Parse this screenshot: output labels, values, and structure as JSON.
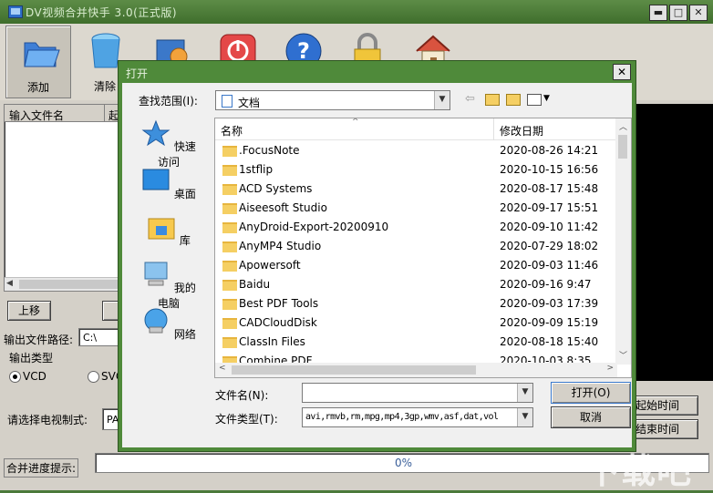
{
  "app": {
    "title": "DV视频合并快手 3.0(正式版)",
    "window_buttons": [
      "▬",
      "□",
      "✕"
    ],
    "toolbar": [
      {
        "label": "添加",
        "icon": "folder-icon"
      },
      {
        "label": "清除",
        "icon": "trash-bin-icon"
      },
      {
        "label": "",
        "icon": "merge-icon"
      },
      {
        "label": "",
        "icon": "stop-icon"
      },
      {
        "label": "",
        "icon": "help-icon"
      },
      {
        "label": "",
        "icon": "lock-icon"
      },
      {
        "label": "",
        "icon": "home-icon"
      }
    ],
    "list_headers": {
      "input_file": "输入文件名",
      "start": "起"
    },
    "move_up": "上移",
    "output_path_label": "输出文件路径:",
    "output_path_value": "C:\\",
    "output_type_label": "输出类型",
    "option_vcd": "VCD",
    "option_svcd": "SVC",
    "tv_standard_label": "请选择电视制式:",
    "tv_standard_value": "PA",
    "set_start_time": "起始时间",
    "set_end_time": "结束时间",
    "progress_label": "合并进度提示:",
    "progress_text": "0%",
    "progress": 0
  },
  "dialog": {
    "title": "打开",
    "close": "✕",
    "look_in_label": "查找范围(I):",
    "look_in_value": "文档",
    "places": [
      {
        "label": "快速访问",
        "icon": "quick-access-star-icon"
      },
      {
        "label": "桌面",
        "icon": "desktop-icon"
      },
      {
        "label": "库",
        "icon": "library-icon"
      },
      {
        "label": "我的电脑",
        "icon": "computer-icon"
      },
      {
        "label": "网络",
        "icon": "network-icon"
      }
    ],
    "columns": {
      "name": "名称",
      "modified": "修改日期"
    },
    "files": [
      {
        "name": ".FocusNote",
        "date": "2020-08-26 14:21"
      },
      {
        "name": "1stflip",
        "date": "2020-10-15 16:56"
      },
      {
        "name": "ACD Systems",
        "date": "2020-08-17 15:48"
      },
      {
        "name": "Aiseesoft Studio",
        "date": "2020-09-17 15:51"
      },
      {
        "name": "AnyDroid-Export-20200910",
        "date": "2020-09-10 11:42"
      },
      {
        "name": "AnyMP4 Studio",
        "date": "2020-07-29 18:02"
      },
      {
        "name": "Apowersoft",
        "date": "2020-09-03 11:46"
      },
      {
        "name": "Baidu",
        "date": "2020-09-16 9:47"
      },
      {
        "name": "Best PDF Tools",
        "date": "2020-09-03 17:39"
      },
      {
        "name": "CADCloudDisk",
        "date": "2020-09-09 15:19"
      },
      {
        "name": "ClassIn Files",
        "date": "2020-08-18 15:40"
      },
      {
        "name": "Combine PDF",
        "date": "2020-10-03 8:35"
      }
    ],
    "filename_label": "文件名(N):",
    "filename_value": "",
    "filetype_label": "文件类型(T):",
    "filetype_value": "avi,rmvb,rm,mpg,mp4,3gp,wmv,asf,dat,vol",
    "open_button": "打开(O)",
    "cancel_button": "取消"
  },
  "watermark": "下载吧",
  "colors": {
    "title_green": "#4f8a3a",
    "folder_yellow": "#f5cf63"
  }
}
